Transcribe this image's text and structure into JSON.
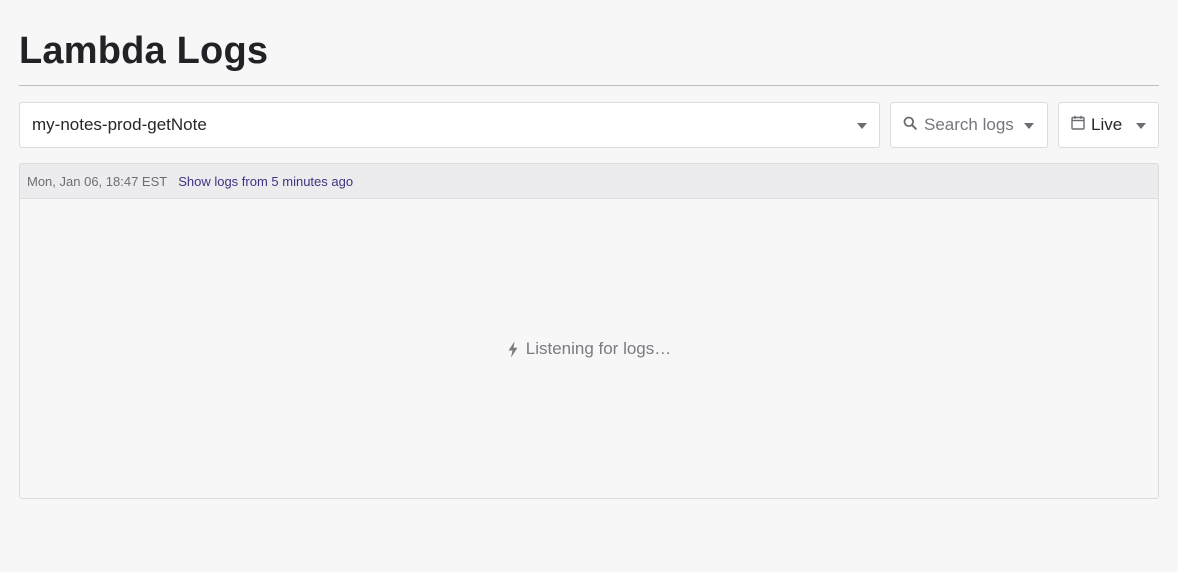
{
  "page": {
    "title": "Lambda Logs"
  },
  "controls": {
    "function_select": {
      "value": "my-notes-prod-getNote"
    },
    "search": {
      "label": "Search logs"
    },
    "range": {
      "label": "Live"
    }
  },
  "log_panel": {
    "timestamp": "Mon, Jan 06, 18:47 EST",
    "show_logs_link": "Show logs from 5 minutes ago",
    "status": "Listening for logs…"
  },
  "icons": {
    "search": "search-icon",
    "calendar": "calendar-icon",
    "bolt": "lightning-bolt-icon",
    "dropdown": "chevron-down-icon"
  },
  "colors": {
    "background": "#f7f7f7",
    "link": "#3d3580",
    "border": "#dcdcdf"
  }
}
